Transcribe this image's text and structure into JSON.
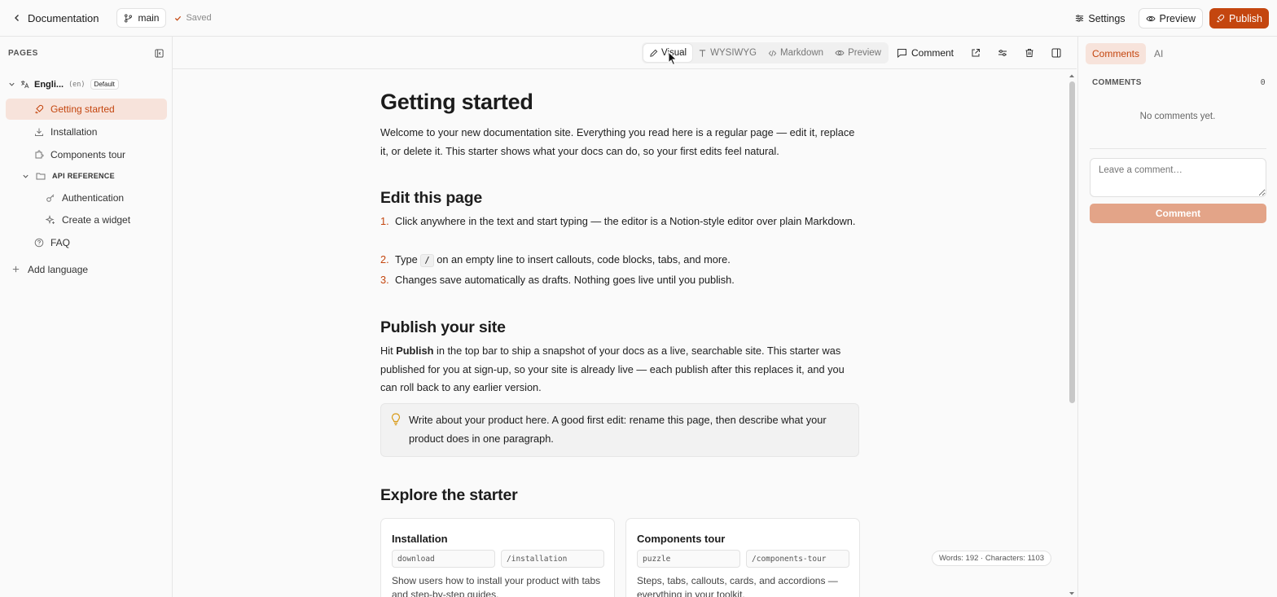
{
  "topbar": {
    "back_label": "Documentation",
    "branch": "main",
    "saved": "Saved",
    "settings": "Settings",
    "preview": "Preview",
    "publish": "Publish"
  },
  "sidebar": {
    "title": "PAGES",
    "language": {
      "name": "Engli...",
      "code": "(en)",
      "badge": "Default"
    },
    "items": [
      {
        "label": "Getting started",
        "icon": "rocket-icon",
        "active": true
      },
      {
        "label": "Installation",
        "icon": "download-icon"
      },
      {
        "label": "Components tour",
        "icon": "puzzle-icon"
      },
      {
        "label": "API REFERENCE",
        "icon": "folder-icon",
        "group": true
      },
      {
        "label": "Authentication",
        "icon": "key-icon"
      },
      {
        "label": "Create a widget",
        "icon": "sparkles-icon"
      },
      {
        "label": "FAQ",
        "icon": "help-circle-icon"
      }
    ],
    "add_language": "Add language"
  },
  "toolbar": {
    "modes": [
      "Visual",
      "WYSIWYG",
      "Markdown",
      "Preview"
    ],
    "active_mode": "Visual",
    "comment": "Comment"
  },
  "doc": {
    "h1": "Getting started",
    "intro": "Welcome to your new documentation site. Everything you read here is a regular page — edit it, replace it, or delete it. This starter shows what your docs can do, so your first edits feel natural.",
    "h2_edit": "Edit this page",
    "steps": [
      {
        "num": "1.",
        "text": "Click anywhere in the text and start typing — the editor is a Notion-style editor over plain Markdown."
      },
      {
        "num": "2.",
        "pre": "Type ",
        "code": "/",
        "post": " on an empty line to insert callouts, code blocks, tabs, and more."
      },
      {
        "num": "3.",
        "text": "Changes save automatically as drafts. Nothing goes live until you publish."
      }
    ],
    "h2_publish": "Publish your site",
    "publish_pre": "Hit ",
    "publish_bold": "Publish",
    "publish_post": " in the top bar to ship a snapshot of your docs as a live, searchable site. This starter was published for you at sign-up, so your site is already live — each publish after this replaces it, and you can roll back to any earlier version.",
    "callout": "Write about your product here. A good first edit: rename this page, then describe what your product does in one paragraph.",
    "h2_explore": "Explore the starter",
    "cards": [
      {
        "title": "Installation",
        "icon_field": "download",
        "path_field": "/installation",
        "desc": "Show users how to install your product with tabs and step-by-step guides."
      },
      {
        "title": "Components tour",
        "icon_field": "puzzle",
        "path_field": "/components-tour",
        "desc": "Steps, tabs, callouts, cards, and accordions — everything in your toolkit."
      }
    ],
    "wordcount": "Words: 192 · Characters: 1103"
  },
  "rpanel": {
    "tabs": [
      "Comments",
      "AI"
    ],
    "heading": "COMMENTS",
    "count": "0",
    "empty": "No comments yet.",
    "placeholder": "Leave a comment…",
    "button": "Comment"
  },
  "colors": {
    "accent": "#c4460f",
    "accent_soft": "#f7e3db"
  }
}
